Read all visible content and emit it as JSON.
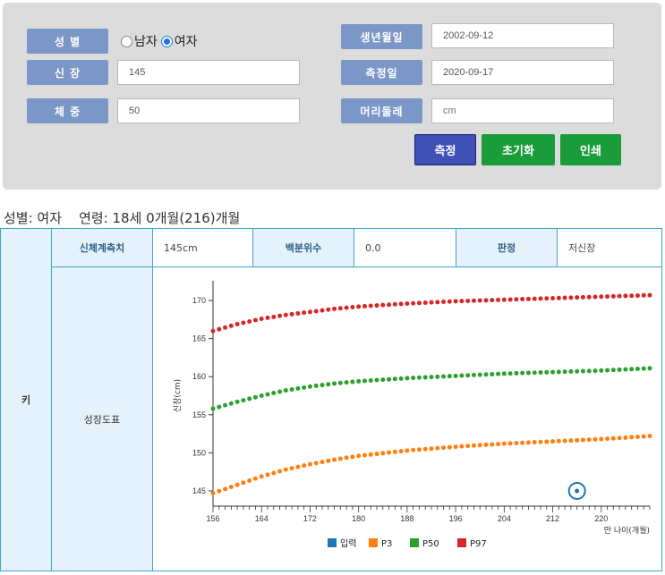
{
  "form": {
    "gender_label": "성 별",
    "gender_options": [
      {
        "label": "남자",
        "checked": false
      },
      {
        "label": "여자",
        "checked": true
      }
    ],
    "height_label": "신 장",
    "height_value": "145",
    "weight_label": "체 중",
    "weight_value": "50",
    "birth_label": "생년월일",
    "birth_value": "2002-09-12",
    "measure_label": "측정일",
    "measure_value": "2020-09-17",
    "head_label": "머리둘레",
    "head_placeholder": "cm",
    "buttons": {
      "measure": "측정",
      "reset": "초기화",
      "print": "인쇄"
    }
  },
  "summary": "성별: 여자    연령: 18세 0개월(216)개월",
  "table": {
    "row_label": "키",
    "col_measure_label": "신체계측치",
    "measure_value": "145cm",
    "percentile_label": "백분위수",
    "percentile_value": "0.0",
    "judgement_label": "판정",
    "judgement_value": "저신장",
    "chart_label": "성장도표"
  },
  "colors": {
    "p3": "#ff7f0e",
    "p50": "#2ca02c",
    "p97": "#d62728",
    "input": "#1f77b4",
    "label_bg": "#7b97c8",
    "btn_measure": "#3f51b5",
    "btn_green": "#1a9c3b"
  },
  "chart_data": {
    "type": "scatter",
    "xlabel": "만 나이(개월)",
    "ylabel": "신장(cm)",
    "xlim": [
      156,
      228
    ],
    "ylim": [
      143,
      172
    ],
    "xticks": [
      156,
      164,
      172,
      180,
      188,
      196,
      204,
      212,
      220
    ],
    "yticks": [
      145,
      150,
      155,
      160,
      165,
      170
    ],
    "x_step": 1,
    "series": [
      {
        "name": "입력",
        "color": "#1f77b4",
        "points": [
          [
            216,
            145
          ]
        ]
      },
      {
        "name": "P3",
        "color": "#ff7f0e",
        "anchors": [
          [
            156,
            144.7
          ],
          [
            160,
            145.8
          ],
          [
            164,
            146.9
          ],
          [
            168,
            147.8
          ],
          [
            172,
            148.5
          ],
          [
            176,
            149.1
          ],
          [
            180,
            149.6
          ],
          [
            188,
            150.3
          ],
          [
            196,
            150.8
          ],
          [
            204,
            151.2
          ],
          [
            212,
            151.5
          ],
          [
            220,
            151.8
          ],
          [
            228,
            152.2
          ]
        ]
      },
      {
        "name": "P50",
        "color": "#2ca02c",
        "anchors": [
          [
            156,
            155.8
          ],
          [
            160,
            156.7
          ],
          [
            164,
            157.5
          ],
          [
            168,
            158.2
          ],
          [
            172,
            158.7
          ],
          [
            176,
            159.1
          ],
          [
            180,
            159.4
          ],
          [
            188,
            159.8
          ],
          [
            196,
            160.1
          ],
          [
            204,
            160.4
          ],
          [
            212,
            160.6
          ],
          [
            220,
            160.8
          ],
          [
            228,
            161.1
          ]
        ]
      },
      {
        "name": "P97",
        "color": "#d62728",
        "anchors": [
          [
            156,
            166.0
          ],
          [
            160,
            166.9
          ],
          [
            164,
            167.6
          ],
          [
            168,
            168.1
          ],
          [
            172,
            168.5
          ],
          [
            176,
            168.9
          ],
          [
            180,
            169.2
          ],
          [
            188,
            169.6
          ],
          [
            196,
            169.9
          ],
          [
            204,
            170.1
          ],
          [
            212,
            170.3
          ],
          [
            220,
            170.5
          ],
          [
            228,
            170.7
          ]
        ]
      }
    ],
    "legend": [
      "입력",
      "P3",
      "P50",
      "P97"
    ],
    "legend_position": "bottom"
  }
}
